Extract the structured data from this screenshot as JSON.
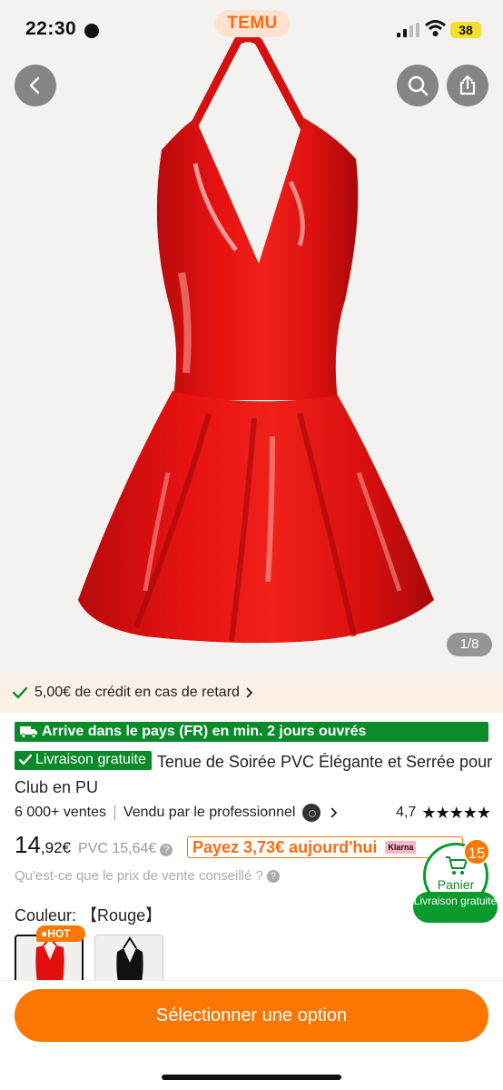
{
  "status_bar": {
    "time": "22:30",
    "logo": "TEMU",
    "battery": "38"
  },
  "gallery": {
    "counter": "1/8",
    "icons": [
      "back-icon",
      "search-icon",
      "share-icon"
    ]
  },
  "credit_banner": {
    "text": "5,00€ de crédit en cas de retard"
  },
  "arrival_badge": {
    "text": "Arrive dans le pays (FR) en min. 2 jours ouvrés"
  },
  "product": {
    "free_shipping": "Livraison gratuite",
    "title": "Tenue de Soirée PVC Élégante et Serrée pour Club en PU",
    "sales": "6 000+ ventes",
    "seller": "Vendu par le professionnel",
    "rating": "4,7",
    "stars": "★★★★★",
    "stars_value": 4.7,
    "price_int": "14",
    "price_dec": ",92€",
    "pvc_price": "PVC 15,64€",
    "pay_today": "Payez 3,73€ aujourd'hui",
    "klarna": "Klarna",
    "pvc_question": "Qu'est-ce que le prix de vente conseillé ?"
  },
  "cart": {
    "label": "Panier",
    "count": "15",
    "shipping": "Livraison gratuite"
  },
  "color": {
    "label": "Couleur:",
    "selected": "【Rouge】",
    "hot_tag": "HOT",
    "options": [
      "Rouge",
      "Noir"
    ]
  },
  "cta": {
    "label": "Sélectionner une option"
  },
  "colors": {
    "accent": "#fb7701",
    "green": "#0a8a2a",
    "dress_red": "#e0100f"
  }
}
